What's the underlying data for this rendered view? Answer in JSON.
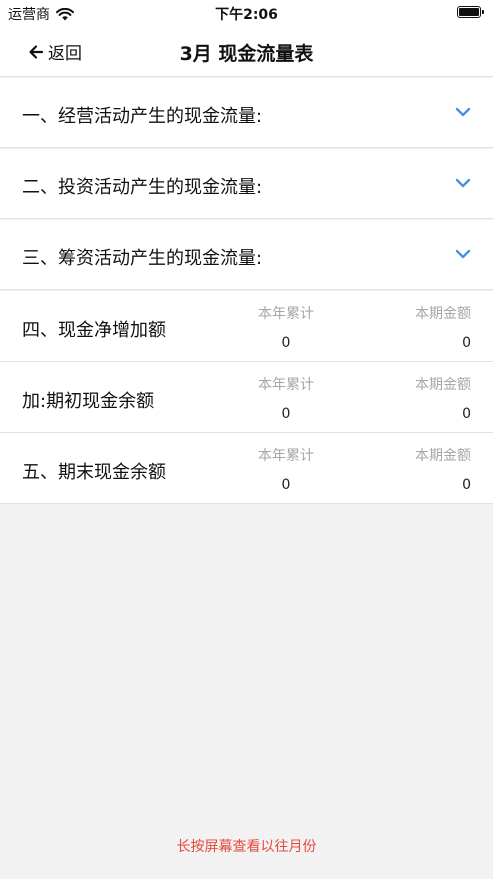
{
  "status_bar": {
    "carrier": "运营商",
    "time": "下午2:06"
  },
  "nav": {
    "back_label": "返回",
    "title": "3月 现金流量表"
  },
  "sections": [
    {
      "label": "一、经营活动产生的现金流量:"
    },
    {
      "label": "二、投资活动产生的现金流量:"
    },
    {
      "label": "三、筹资活动产生的现金流量:"
    }
  ],
  "rows": [
    {
      "label": "四、现金净增加额",
      "ytd_header": "本年累计",
      "ytd_value": "0",
      "period_header": "本期金额",
      "period_value": "0"
    },
    {
      "label": "加:期初现金余额",
      "ytd_header": "本年累计",
      "ytd_value": "0",
      "period_header": "本期金额",
      "period_value": "0"
    },
    {
      "label": "五、期末现金余额",
      "ytd_header": "本年累计",
      "ytd_value": "0",
      "period_header": "本期金额",
      "period_value": "0"
    }
  ],
  "footer": {
    "hint": "长按屏幕查看以往月份"
  },
  "colors": {
    "accent_blue": "#4a90e2",
    "hint_red": "#e8493f",
    "muted_gray": "#a6a6a6",
    "background": "#f2f2f2"
  },
  "icons": {
    "wifi": "wifi-icon",
    "battery": "battery-icon",
    "back": "arrow-left-icon",
    "expand": "chevron-down-icon"
  }
}
